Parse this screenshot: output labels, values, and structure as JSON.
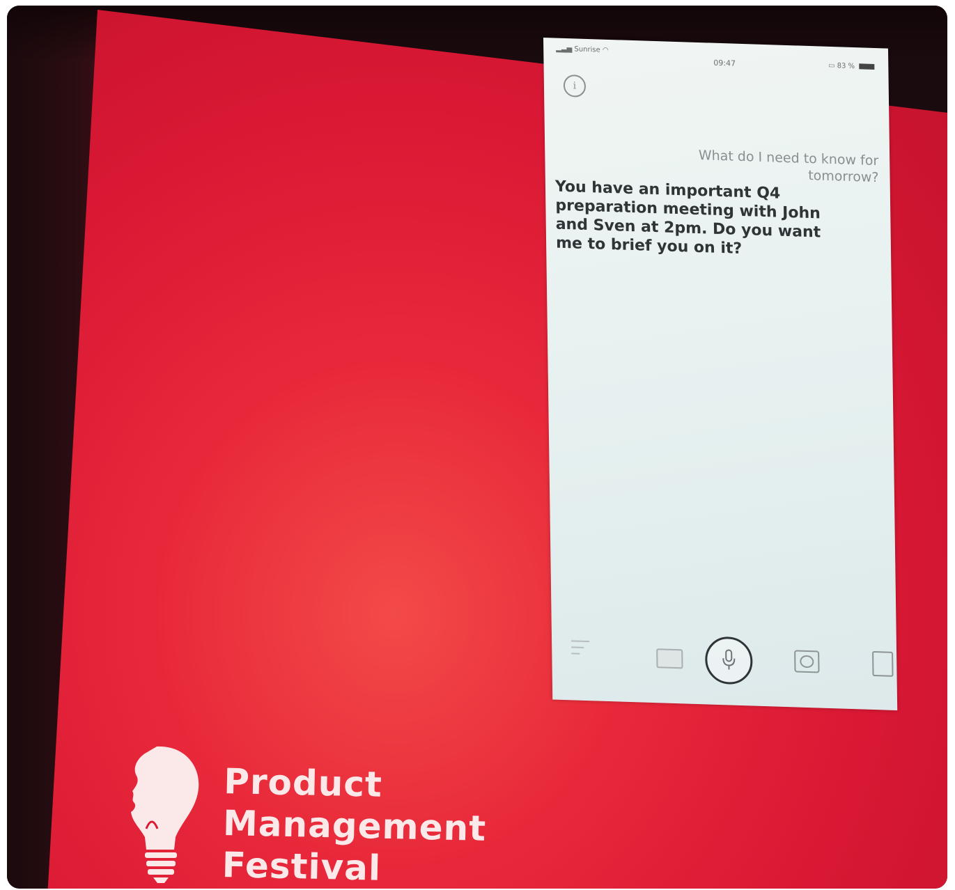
{
  "phone": {
    "status": {
      "carrier": "Sunrise",
      "time": "09:47",
      "battery": "83 %"
    },
    "info_icon": "i",
    "user_query": "What do I need to know for tomorrow?",
    "assistant_reply": "You have an important Q4 preparation meeting with John and Sven at 2pm. Do you want me to brief you on it?",
    "toolbar_icons": [
      "menu-icon",
      "keyboard-icon",
      "microphone-icon",
      "scan-icon",
      "card-icon"
    ]
  },
  "logo": {
    "line1": "Product",
    "line2": "Management",
    "line3": "Festival"
  },
  "colors": {
    "slide_red": "#d91834",
    "phone_bg": "#e8f2f1",
    "logo_text": "#fbe9ea"
  }
}
